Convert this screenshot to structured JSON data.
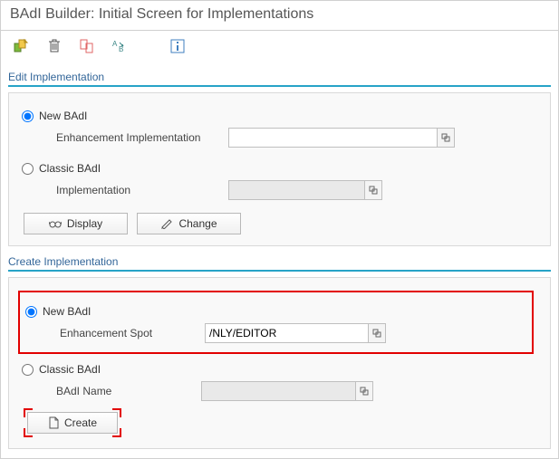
{
  "title": "BAdI Builder: Initial Screen for Implementations",
  "toolbar": {
    "other_object": "Other Object",
    "delete": "Delete",
    "copy": "Copy",
    "rename": "Rename",
    "info": "Info"
  },
  "edit": {
    "header": "Edit Implementation",
    "new_badi": "New BAdI",
    "enh_impl_label": "Enhancement Implementation",
    "enh_impl_value": "",
    "classic_badi": "Classic BAdI",
    "impl_label": "Implementation",
    "impl_value": "",
    "display": "Display",
    "change": "Change"
  },
  "create": {
    "header": "Create Implementation",
    "new_badi": "New BAdI",
    "enh_spot_label": "Enhancement Spot",
    "enh_spot_value": "/NLY/EDITOR",
    "classic_badi": "Classic BAdI",
    "badi_name_label": "BAdI Name",
    "badi_name_value": "",
    "create": "Create"
  }
}
